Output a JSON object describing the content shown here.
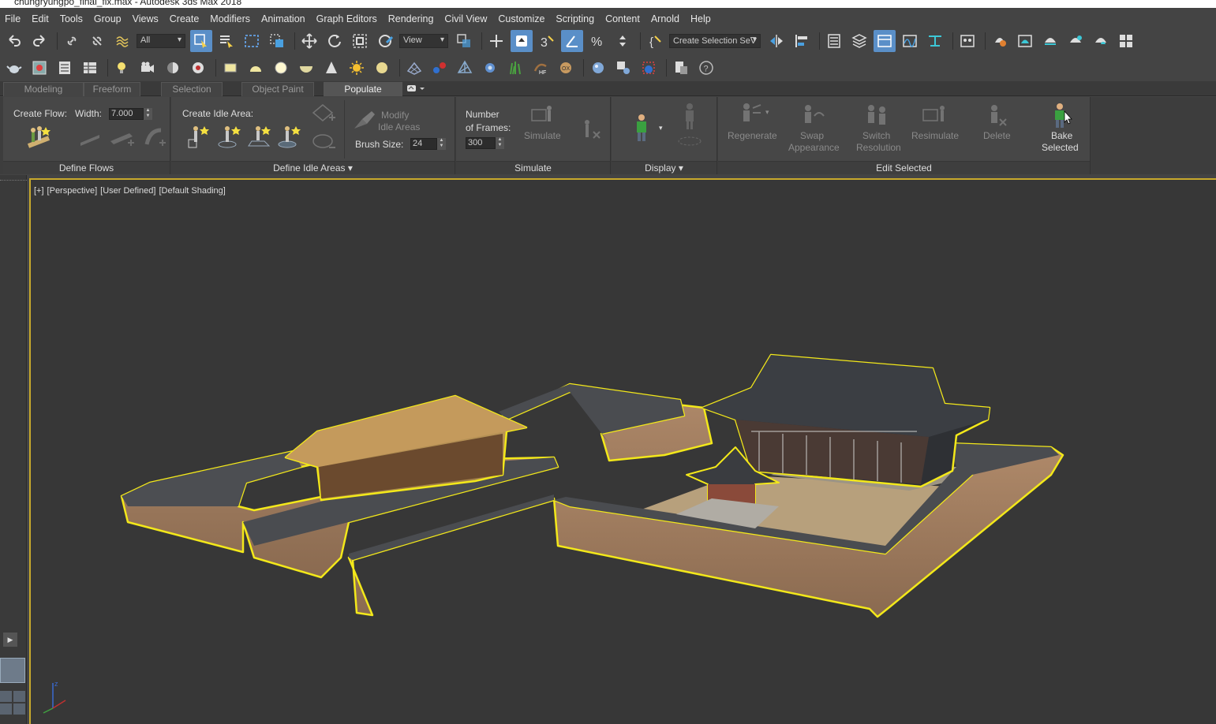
{
  "window": {
    "title": "chungryungpo_final_fix.max - Autodesk 3ds Max 2018"
  },
  "menu": [
    "File",
    "Edit",
    "Tools",
    "Group",
    "Views",
    "Create",
    "Modifiers",
    "Animation",
    "Graph Editors",
    "Rendering",
    "Civil View",
    "Customize",
    "Scripting",
    "Content",
    "Arnold",
    "Help"
  ],
  "toolbar": {
    "selection_filter": "All",
    "reference_coord": "View",
    "named_selection": "Create Selection Se∇"
  },
  "ribbon_tabs": [
    "Modeling",
    "Freeform",
    "Selection",
    "Object Paint",
    "Populate"
  ],
  "ribbon_active_tab": "Populate",
  "ribbon": {
    "define_flows": {
      "create_flow_label": "Create Flow:",
      "width_label": "Width:",
      "width_value": "7.000",
      "footer": "Define Flows"
    },
    "define_idle_areas": {
      "create_idle_label": "Create Idle Area:",
      "modify_label_1": "Modify",
      "modify_label_2": "Idle Areas",
      "brush_size_label": "Brush Size:",
      "brush_size_value": "24",
      "footer": "Define Idle Areas ▾"
    },
    "simulate": {
      "frames_label_1": "Number",
      "frames_label_2": "of Frames:",
      "frames_value": "300",
      "simulate_label": "Simulate",
      "footer": "Simulate"
    },
    "display": {
      "footer": "Display ▾"
    },
    "edit_selected": {
      "regenerate": "Regenerate",
      "swap_1": "Swap",
      "swap_2": "Appearance",
      "switch_1": "Switch",
      "switch_2": "Resolution",
      "resimulate": "Resimulate",
      "delete": "Delete",
      "bake_1": "Bake",
      "bake_2": "Selected",
      "footer": "Edit Selected"
    }
  },
  "viewport": {
    "label_plus": "[+]",
    "label_view": "[Perspective]",
    "label_camera": "[User Defined]",
    "label_shading": "[Default Shading]",
    "axis_z": "z"
  },
  "colors": {
    "selection_outline": "#f3e81a",
    "active_viewport_border": "#c8a92c",
    "active_button": "#5a8fc8"
  }
}
